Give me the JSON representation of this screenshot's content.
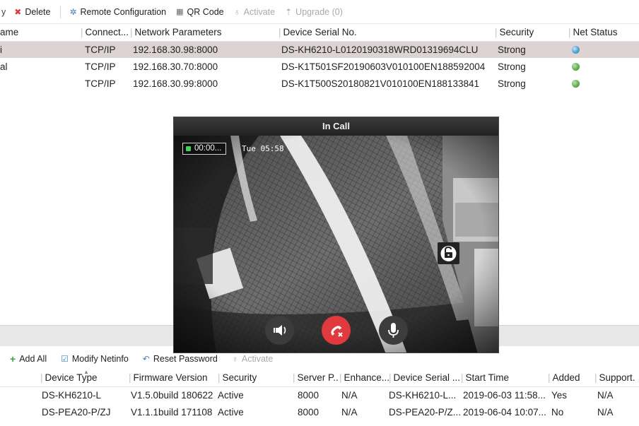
{
  "toolbar": {
    "partial_left": "y",
    "delete": "Delete",
    "remote_config": "Remote Configuration",
    "qr_code": "QR Code",
    "activate": "Activate",
    "upgrade": "Upgrade (0)"
  },
  "online_table": {
    "columns": [
      "ame",
      "Connect...",
      "Network Parameters",
      "Device Serial No.",
      "Security",
      "Net Status"
    ],
    "rows": [
      {
        "name": "i",
        "conn": "TCP/IP",
        "net": "192.168.30.98:8000",
        "serial": "DS-KH6210-L0120190318WRD01319694CLU",
        "security": "Strong",
        "status_icon": "globe-icon"
      },
      {
        "name": "al",
        "conn": "TCP/IP",
        "net": "192.168.30.70:8000",
        "serial": "DS-K1T501SF20190603V010100EN188592004",
        "security": "Strong",
        "status_icon": "online-icon"
      },
      {
        "name": "",
        "conn": "TCP/IP",
        "net": "192.168.30.99:8000",
        "serial": "DS-K1T500S20180821V010100EN188133841",
        "security": "Strong",
        "status_icon": "online-icon"
      }
    ]
  },
  "call": {
    "title": "In Call",
    "timer": "00:00...",
    "osd_time": "Tue 05:58",
    "icons": [
      "unlock-icon",
      "volume-icon",
      "hangup-icon",
      "microphone-icon"
    ]
  },
  "toolbar2": {
    "add_all": "Add All",
    "modify_netinfo": "Modify Netinfo",
    "reset_password": "Reset Password",
    "activate": "Activate"
  },
  "online_devices": {
    "columns": [
      "Device Type",
      "Firmware Version",
      "Security",
      "Server P...",
      "Enhance...",
      "Device Serial ...",
      "Start Time",
      "Added",
      "Support."
    ],
    "rows": [
      {
        "type": "DS-KH6210-L",
        "firmware": "V1.5.0build 180622",
        "security": "Active",
        "port": "8000",
        "enhance": "N/A",
        "serial": "DS-KH6210-L...",
        "start": "2019-06-03 11:58...",
        "added": "Yes",
        "support": "N/A"
      },
      {
        "type": "DS-PEA20-P/ZJ",
        "firmware": "V1.1.1build 171108",
        "security": "Active",
        "port": "8000",
        "enhance": "N/A",
        "serial": "DS-PEA20-P/Z...",
        "start": "2019-06-04 10:07...",
        "added": "No",
        "support": "N/A"
      }
    ]
  },
  "colors": {
    "selected_row": "#dcd3d2",
    "delete_icon": "#e0393e",
    "hangup": "#e0393e",
    "timer_dot": "#3fd35b"
  }
}
